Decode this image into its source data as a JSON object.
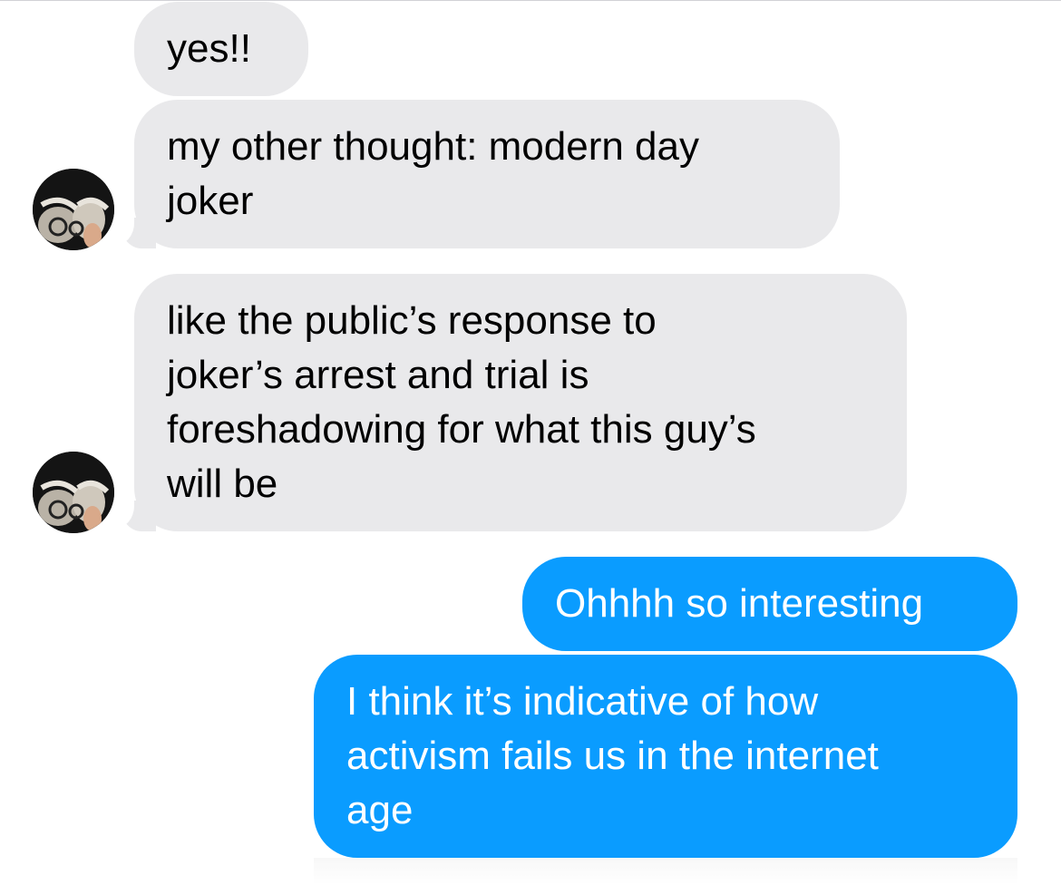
{
  "conversation": {
    "messages": [
      {
        "sender": "other",
        "lines": [
          "yes!!"
        ]
      },
      {
        "sender": "other",
        "lines": [
          "my other thought: modern day",
          "joker"
        ]
      },
      {
        "sender": "other",
        "lines": [
          "like the public’s response to",
          "joker’s arrest and trial is",
          "foreshadowing for what this guy’s",
          "will be"
        ]
      },
      {
        "sender": "me",
        "lines": [
          "Ohhhh so interesting"
        ]
      },
      {
        "sender": "me",
        "lines": [
          "I think it’s indicative of how",
          "activism fails us in the internet",
          "age"
        ]
      }
    ]
  },
  "colors": {
    "incoming_bubble": "#e9e9eb",
    "outgoing_bubble": "#0a9cff",
    "incoming_text": "#000000",
    "outgoing_text": "#ffffff"
  },
  "icons": {
    "avatar": "contact-avatar-photo"
  }
}
